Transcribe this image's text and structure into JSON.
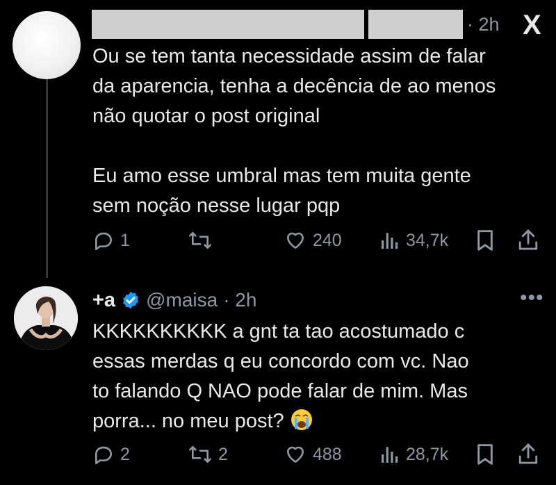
{
  "tweet1": {
    "time": "· 2h",
    "logo": "X",
    "text": "Ou se tem tanta necessidade assim de falar\nda aparencia, tenha a decência de ao menos\nnão quotar o post original\n\nEu amo esse umbral mas tem muita gente\nsem noção nesse lugar pqp",
    "replies": "1",
    "retweets": "",
    "likes": "240",
    "views": "34,7k"
  },
  "tweet2": {
    "name": "+a",
    "handle": "@maisa",
    "time": "· 2h",
    "more": "•••",
    "text": "KKKKKKKKKK a gnt ta tao acostumado c\nessas merdas q eu concordo com vc. Nao\nto falando Q NAO pode falar de mim. Mas\nporra... no meu post?",
    "replies": "2",
    "retweets": "2",
    "likes": "488",
    "views": "28,7k"
  },
  "icons": {
    "reply": "reply-icon",
    "retweet": "retweet-icon",
    "like": "heart-icon",
    "views": "views-icon",
    "bookmark": "bookmark-icon",
    "share": "share-icon",
    "verified": "verified-badge-icon",
    "emoji": "loudly-crying-face-emoji"
  },
  "colors": {
    "background": "#000000",
    "text": "#e7e9ea",
    "muted": "#8b98a5",
    "verified": "#1d9bf0"
  }
}
